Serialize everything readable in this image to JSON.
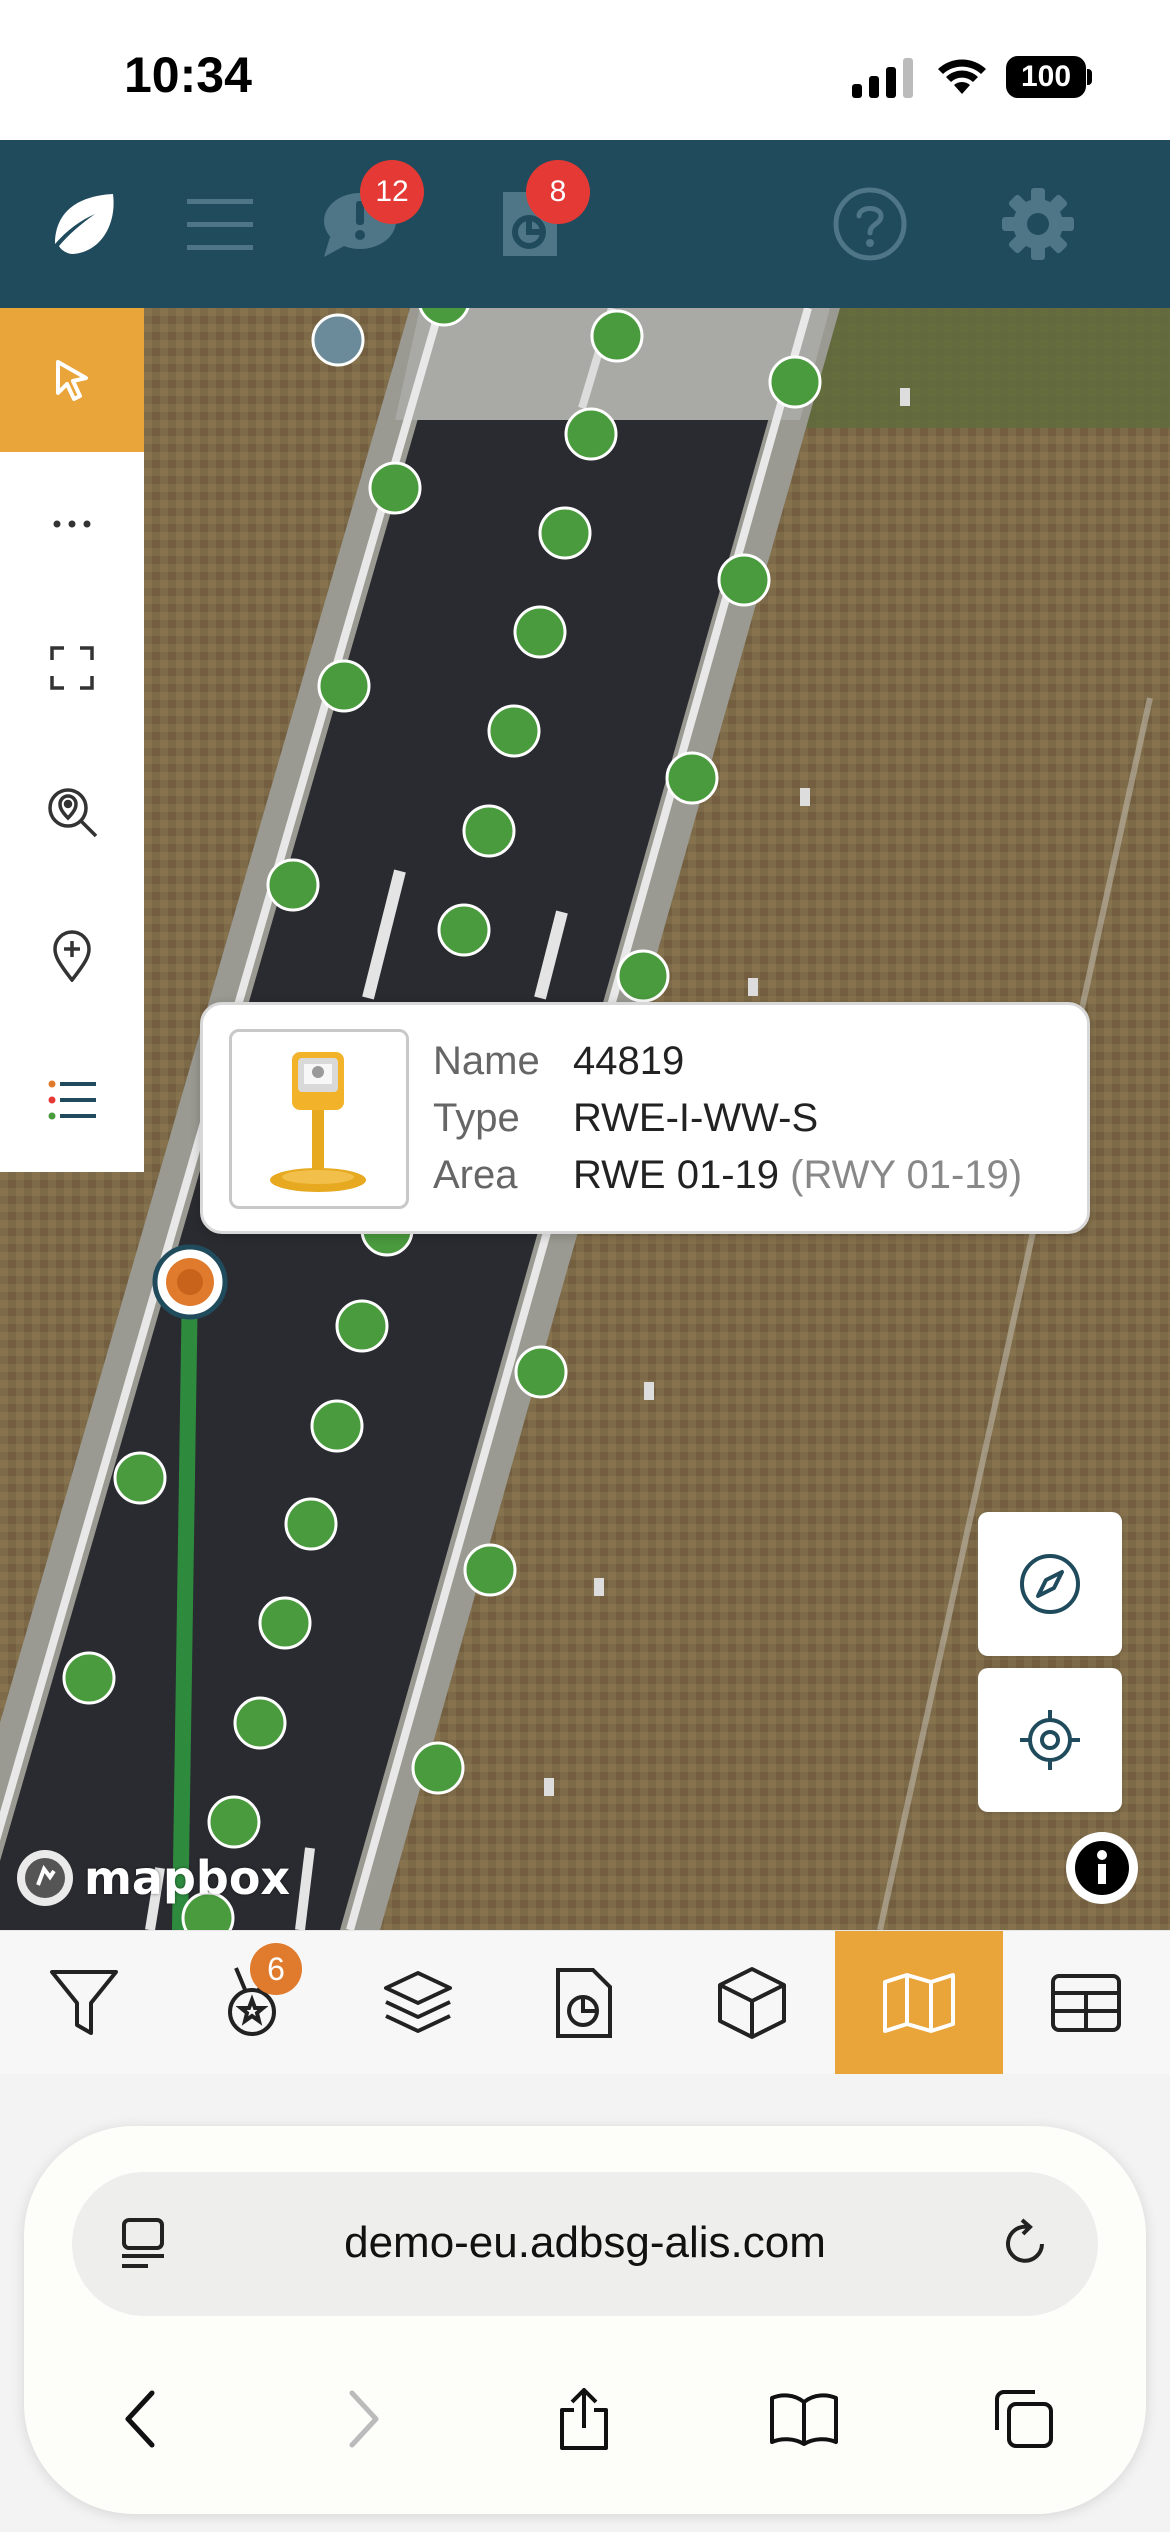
{
  "status_bar": {
    "time": "10:34",
    "battery": "100"
  },
  "header": {
    "alerts_badge": "12",
    "reports_badge": "8",
    "icons": [
      "logo-leaf-icon",
      "menu-icon",
      "alert-chat-icon",
      "report-icon",
      "help-icon",
      "gear-icon"
    ]
  },
  "left_toolbar": {
    "tools": [
      "select-pointer-icon",
      "more-icon",
      "fullscreen-icon",
      "zoom-to-location-icon",
      "add-pin-icon",
      "legend-list-icon"
    ],
    "active": "select-pointer-icon"
  },
  "popup": {
    "name_label": "Name",
    "name_value": "44819",
    "type_label": "Type",
    "type_value": "RWE-I-WW-S",
    "area_label": "Area",
    "area_value": "RWE 01-19",
    "area_extra": "(RWY 01-19)"
  },
  "map": {
    "attribution": "mapbox",
    "colors": {
      "light_ok": "#4a9a3e",
      "selected": "#e07a2c",
      "grey": "#6b8a9a"
    }
  },
  "tabbar": {
    "tabs": [
      "filter-icon",
      "award-icon",
      "layers-icon",
      "report-chart-icon",
      "cube-3d-icon",
      "map-icon",
      "table-icon"
    ],
    "active": "map-icon",
    "award_badge": "6"
  },
  "browser": {
    "url": "demo-eu.adbsg-alis.com",
    "nav": [
      "back-icon",
      "forward-icon",
      "share-icon",
      "bookmarks-icon",
      "tabs-icon"
    ]
  }
}
